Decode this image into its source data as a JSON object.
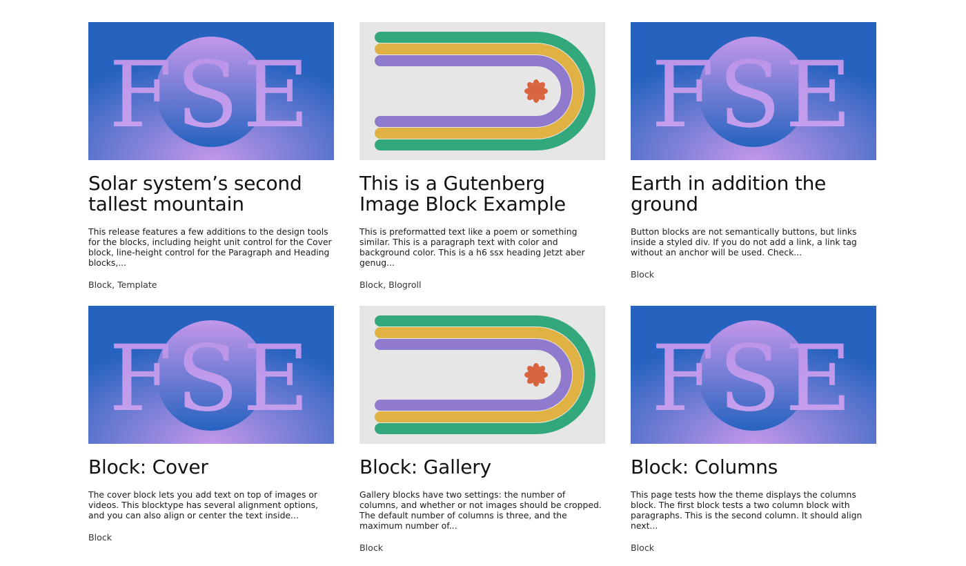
{
  "colors": {
    "cover_blue": "#2563bf",
    "cover_purple": "#c397ea",
    "gallery_bg": "#e6e6e6",
    "stripe_green": "#33a87a",
    "stripe_yellow": "#e0b244",
    "stripe_purple": "#8f7acd",
    "flower_orange": "#d96440"
  },
  "posts": [
    {
      "image": "fse-logo",
      "logo_text": "FSE",
      "title": "Solar system’s second tallest mountain",
      "excerpt": "This release features a few additions to the design tools for the blocks, including height unit control for the Cover block, line-height control for the Paragraph and Heading blocks,...",
      "categories": [
        "Block",
        "Template"
      ]
    },
    {
      "image": "rainbow-arch",
      "title": "This is a Gutenberg Image Block Example",
      "excerpt": "This is preformatted text like a poem or something similar. This is a paragraph text with color and background color. This is a h6 ssx heading Jetzt aber genug...",
      "categories": [
        "Block",
        "Blogroll"
      ]
    },
    {
      "image": "fse-logo",
      "logo_text": "FSE",
      "title": "Earth in addition the ground",
      "excerpt": "Button blocks are not semantically buttons, but links inside a styled div.  If you do not add a link, a link tag without an anchor will be used. Check...",
      "categories": [
        "Block"
      ]
    },
    {
      "image": "fse-logo",
      "logo_text": "FSE",
      "title": "Block: Cover",
      "excerpt": "The cover block lets you add text on top of images or videos. This blocktype has several alignment options, and you can also align or center the text inside...",
      "categories": [
        "Block"
      ]
    },
    {
      "image": "rainbow-arch",
      "title": "Block: Gallery",
      "excerpt": "Gallery blocks have two settings: the number of columns, and whether or not images should be cropped. The default number of columns is three, and the maximum number of...",
      "categories": [
        "Block"
      ]
    },
    {
      "image": "fse-logo",
      "logo_text": "FSE",
      "title": "Block: Columns",
      "excerpt": "This page tests how the theme displays the columns block. The first block tests a two column block with paragraphs. This is the second column. It should align next...",
      "categories": [
        "Block"
      ]
    }
  ]
}
